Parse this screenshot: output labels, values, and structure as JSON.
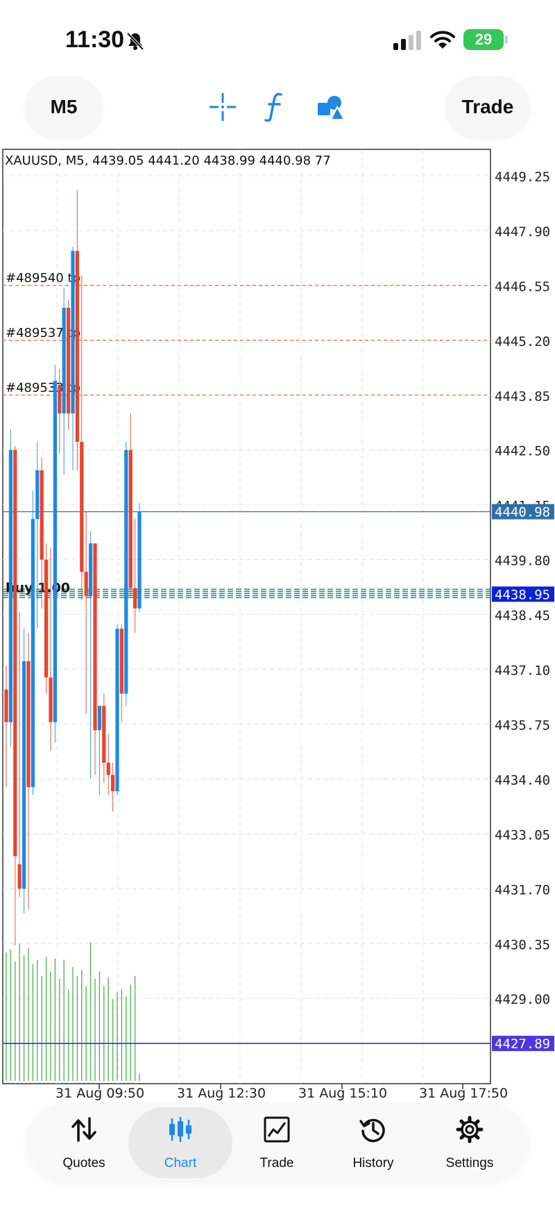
{
  "status_bar": {
    "time": "11:30",
    "battery": "29"
  },
  "toolbar": {
    "timeframe": "M5",
    "trade": "Trade",
    "icons": [
      "crosshair-icon",
      "function-icon",
      "objects-icon"
    ],
    "accent": "#1e88e5"
  },
  "chart": {
    "header": "XAUUSD, M5, 4439.05 4441.20 4438.99 4440.98 77",
    "order_labels": [
      "#489540 tp",
      "#489537 tp",
      "#489533 tp"
    ],
    "position_label": "buy 1.00",
    "current_price_tag": "4440.98",
    "bid_tag": "4438.95",
    "alert_tag": "4427.89",
    "price_ticks": [
      "4449.25",
      "4447.90",
      "4446.55",
      "4445.20",
      "4443.85",
      "4442.50",
      "4441.15",
      "4439.80",
      "4438.45",
      "4437.10",
      "4435.75",
      "4434.40",
      "4433.05",
      "4431.70",
      "4430.35",
      "4429.00"
    ],
    "time_ticks": [
      "31 Aug 09:50",
      "31 Aug 12:30",
      "31 Aug 15:10",
      "31 Aug 17:50"
    ],
    "colors": {
      "bull": "#1e88e5",
      "bear": "#e8442c",
      "volume": "#4caf50",
      "tp_line": "#ef7b5e",
      "price_tag": "#2f6fa8",
      "bid_tag": "#0a23d8",
      "alert_tag": "#4e35e0"
    }
  },
  "chart_data": {
    "type": "candlestick",
    "symbol": "XAUUSD",
    "timeframe": "M5",
    "x_ticks": [
      "31 Aug 09:50",
      "31 Aug 12:30",
      "31 Aug 15:10",
      "31 Aug 17:50"
    ],
    "ylim": [
      4426.9,
      4449.9
    ],
    "candles": [
      {
        "o": 4436.6,
        "h": 4437.2,
        "l": 4434.2,
        "c": 4435.8
      },
      {
        "o": 4435.8,
        "h": 4443.0,
        "l": 4435.2,
        "c": 4442.5
      },
      {
        "o": 4442.5,
        "h": 4442.6,
        "l": 4430.3,
        "c": 4432.5
      },
      {
        "o": 4432.3,
        "h": 4438.5,
        "l": 4431.5,
        "c": 4431.7
      },
      {
        "o": 4431.7,
        "h": 4438.1,
        "l": 4431.1,
        "c": 4437.3
      },
      {
        "o": 4437.3,
        "h": 4438.0,
        "l": 4431.2,
        "c": 4434.2
      },
      {
        "o": 4434.2,
        "h": 4441.5,
        "l": 4434.0,
        "c": 4440.8
      },
      {
        "o": 4440.8,
        "h": 4442.7,
        "l": 4438.1,
        "c": 4442.0
      },
      {
        "o": 4442.0,
        "h": 4442.3,
        "l": 4438.6,
        "c": 4439.8
      },
      {
        "o": 4439.8,
        "h": 4440.2,
        "l": 4436.5,
        "c": 4436.9
      },
      {
        "o": 4436.9,
        "h": 4440.1,
        "l": 4435.1,
        "c": 4435.8
      },
      {
        "o": 4435.8,
        "h": 4444.6,
        "l": 4435.3,
        "c": 4444.2
      },
      {
        "o": 4444.1,
        "h": 4444.5,
        "l": 4442.4,
        "c": 4443.4
      },
      {
        "o": 4443.4,
        "h": 4446.5,
        "l": 4441.9,
        "c": 4446.0
      },
      {
        "o": 4446.0,
        "h": 4446.2,
        "l": 4443.0,
        "c": 4443.4
      },
      {
        "o": 4443.4,
        "h": 4447.5,
        "l": 4442.0,
        "c": 4447.4
      },
      {
        "o": 4447.4,
        "h": 4448.9,
        "l": 4442.0,
        "c": 4442.7
      },
      {
        "o": 4442.7,
        "h": 4446.8,
        "l": 4438.8,
        "c": 4439.5
      },
      {
        "o": 4439.5,
        "h": 4441.0,
        "l": 4436.0,
        "c": 4438.9
      },
      {
        "o": 4438.9,
        "h": 4440.5,
        "l": 4434.4,
        "c": 4440.2
      },
      {
        "o": 4440.2,
        "h": 4440.2,
        "l": 4434.5,
        "c": 4435.6
      },
      {
        "o": 4435.6,
        "h": 4436.2,
        "l": 4434.0,
        "c": 4436.2
      },
      {
        "o": 4436.2,
        "h": 4436.5,
        "l": 4434.3,
        "c": 4434.8
      },
      {
        "o": 4434.8,
        "h": 4435.5,
        "l": 4434.0,
        "c": 4434.5
      },
      {
        "o": 4434.5,
        "h": 4434.8,
        "l": 4433.6,
        "c": 4434.1
      },
      {
        "o": 4434.1,
        "h": 4438.2,
        "l": 4434.0,
        "c": 4438.1
      },
      {
        "o": 4438.1,
        "h": 4438.2,
        "l": 4435.8,
        "c": 4436.5
      },
      {
        "o": 4436.5,
        "h": 4442.7,
        "l": 4436.2,
        "c": 4442.5
      },
      {
        "o": 4442.5,
        "h": 4443.4,
        "l": 4438.9,
        "c": 4439.1
      },
      {
        "o": 4439.1,
        "h": 4440.8,
        "l": 4438.0,
        "c": 4438.6
      },
      {
        "o": 4438.6,
        "h": 4441.2,
        "l": 4438.5,
        "c": 4440.98
      }
    ],
    "volume": [
      88,
      90,
      82,
      94,
      86,
      91,
      80,
      83,
      72,
      85,
      75,
      84,
      70,
      83,
      62,
      78,
      72,
      76,
      65,
      95,
      70,
      75,
      65,
      71,
      56,
      61,
      63,
      58,
      66,
      72,
      5
    ],
    "price_lines": [
      {
        "label": "#489540 tp",
        "price": 4446.55
      },
      {
        "label": "#489537 tp",
        "price": 4445.2
      },
      {
        "label": "#489533 tp",
        "price": 4443.85
      },
      {
        "label": "current",
        "price": 4440.98
      },
      {
        "label": "bid",
        "price": 4438.95
      },
      {
        "label": "alert",
        "price": 4427.89
      }
    ]
  },
  "tabs": [
    {
      "label": "Quotes",
      "icon": "quotes-icon"
    },
    {
      "label": "Chart",
      "icon": "chart-icon",
      "active": true
    },
    {
      "label": "Trade",
      "icon": "trade-icon"
    },
    {
      "label": "History",
      "icon": "history-icon"
    },
    {
      "label": "Settings",
      "icon": "settings-icon"
    }
  ]
}
